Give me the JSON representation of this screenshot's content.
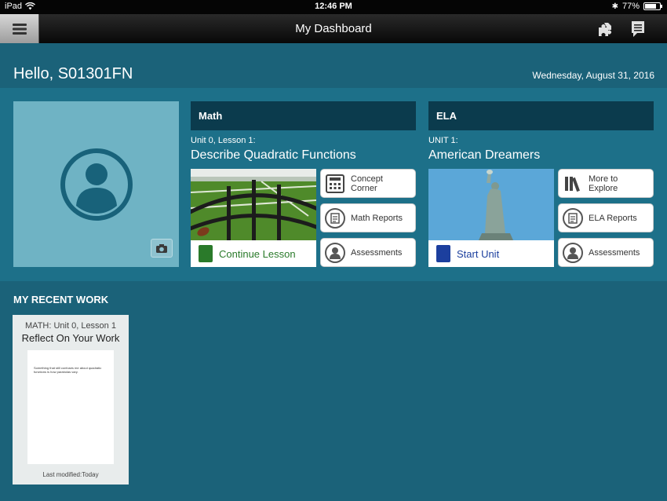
{
  "status": {
    "device": "iPad",
    "time": "12:46 PM",
    "battery": "77%",
    "battery_level": 0.77
  },
  "nav": {
    "title": "My Dashboard",
    "icons": [
      "menu-icon",
      "puzzle-icon",
      "notes-icon"
    ]
  },
  "header": {
    "greeting": "Hello, S01301FN",
    "date": "Wednesday, August 31, 2016"
  },
  "math": {
    "header": "Math",
    "unit_label": "Unit 0, Lesson 1:",
    "unit_title": "Describe Quadratic Functions",
    "cta": "Continue Lesson",
    "buttons": [
      "Concept Corner",
      "Math Reports",
      "Assessments"
    ],
    "accent": "#2a7a2a"
  },
  "ela": {
    "header": "ELA",
    "unit_label": "UNIT 1:",
    "unit_title": "American Dreamers",
    "cta": "Start Unit",
    "buttons": [
      "More to Explore",
      "ELA Reports",
      "Assessments"
    ],
    "accent": "#1c3f9e"
  },
  "recent": {
    "title": "MY RECENT WORK",
    "card": {
      "subtitle": "MATH: Unit 0, Lesson 1",
      "title": "Reflect On Your Work",
      "preview": "Something that still confuses me about quadratic functions is how parabolas vary.",
      "modified": "Last modified:Today"
    }
  }
}
